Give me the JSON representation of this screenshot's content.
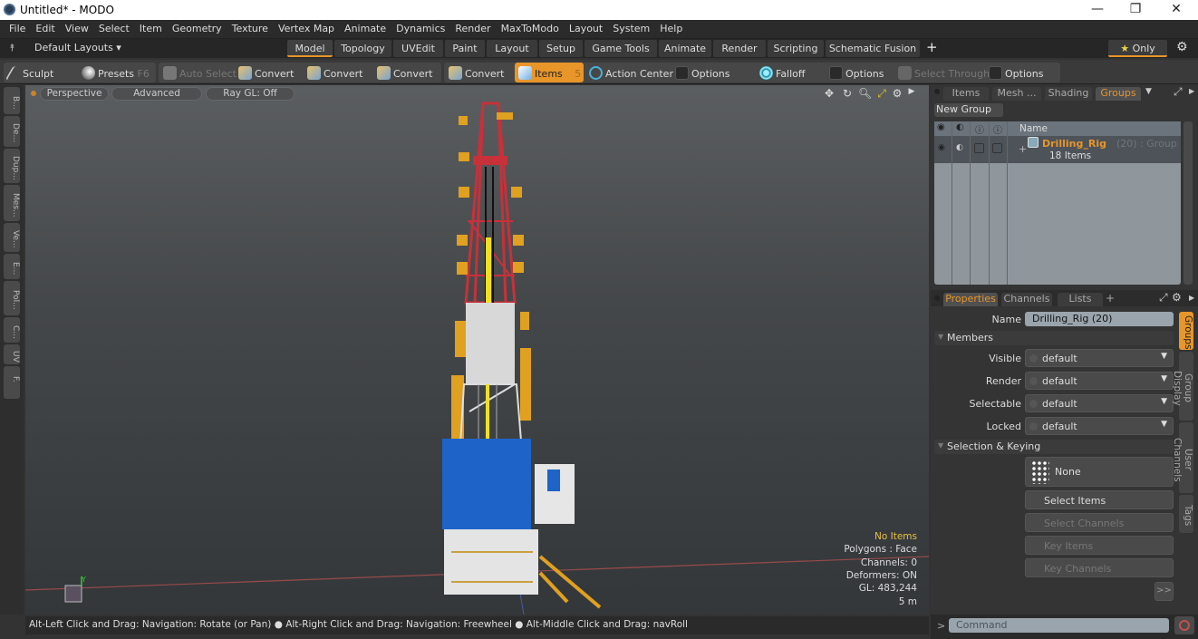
{
  "window": {
    "title": "Untitled* - MODO",
    "minimize": "—",
    "maximize": "❐",
    "close": "✕"
  },
  "menu": [
    "File",
    "Edit",
    "View",
    "Select",
    "Item",
    "Geometry",
    "Texture",
    "Vertex Map",
    "Animate",
    "Dynamics",
    "Render",
    "MaxToModo",
    "Layout",
    "System",
    "Help"
  ],
  "layoutbar": {
    "layouts_label": "Default Layouts ▾",
    "tabs": [
      "Model",
      "Topology",
      "UVEdit",
      "Paint",
      "Layout",
      "Setup",
      "Game Tools",
      "Animate",
      "Render",
      "Scripting",
      "Schematic Fusion"
    ],
    "active_tab": "Model",
    "add": "+",
    "only": "Only"
  },
  "toolbar": {
    "sculpt": "Sculpt",
    "presets": "Presets",
    "presets_key": "F6",
    "auto_select": "Auto Select",
    "convert": [
      "Convert",
      "Convert",
      "Convert",
      "Convert"
    ],
    "items": "Items",
    "items_key": "5",
    "action_center": "Action Center",
    "options1": "Options",
    "falloff": "Falloff",
    "options2": "Options",
    "select_through": "Select Through",
    "options3": "Options"
  },
  "leftstrip": [
    "B...",
    "De...",
    "Dup...",
    "Mes...",
    "Ve...",
    "E...",
    "Pol...",
    "C...",
    "UV",
    "F..."
  ],
  "viewport": {
    "view": "Perspective",
    "shading": "Advanced",
    "raygl": "Ray GL: Off",
    "info": {
      "items": "No Items",
      "polygons": "Polygons : Face",
      "channels": "Channels: 0",
      "deformers": "Deformers: ON",
      "gl": "GL: 483,244",
      "scale": "5 m"
    },
    "axis_label": "Y"
  },
  "status": "Alt-Left Click and Drag: Navigation: Rotate (or Pan) ● Alt-Right Click and Drag: Navigation: Freewheel ● Alt-Middle Click and Drag: navRoll",
  "groups_panel": {
    "tabs": [
      "Items",
      "Mesh ...",
      "Shading",
      "Groups"
    ],
    "active_tab": "Groups",
    "new_group": "New Group",
    "col_name": "Name",
    "group": {
      "name": "Drilling_Rig",
      "suffix": "(20) : Group",
      "count": "18 Items"
    }
  },
  "properties": {
    "tabs": [
      "Properties",
      "Channels",
      "Lists"
    ],
    "active_tab": "Properties",
    "add": "+",
    "name_label": "Name",
    "name_value": "Drilling_Rig (20)",
    "members_header": "Members",
    "members": [
      {
        "label": "Visible",
        "value": "default"
      },
      {
        "label": "Render",
        "value": "default"
      },
      {
        "label": "Selectable",
        "value": "default"
      },
      {
        "label": "Locked",
        "value": "default"
      }
    ],
    "selection_header": "Selection & Keying",
    "none_label": "None",
    "select_items": "Select Items",
    "select_channels": "Select Channels",
    "key_items": "Key Items",
    "key_channels": "Key Channels",
    "more": ">>",
    "side_tabs": [
      "Groups",
      "Group Display",
      "User Channels",
      "Tags"
    ]
  },
  "command": {
    "prompt": ">",
    "placeholder": "Command"
  },
  "colors": {
    "accent": "#e8952a"
  }
}
